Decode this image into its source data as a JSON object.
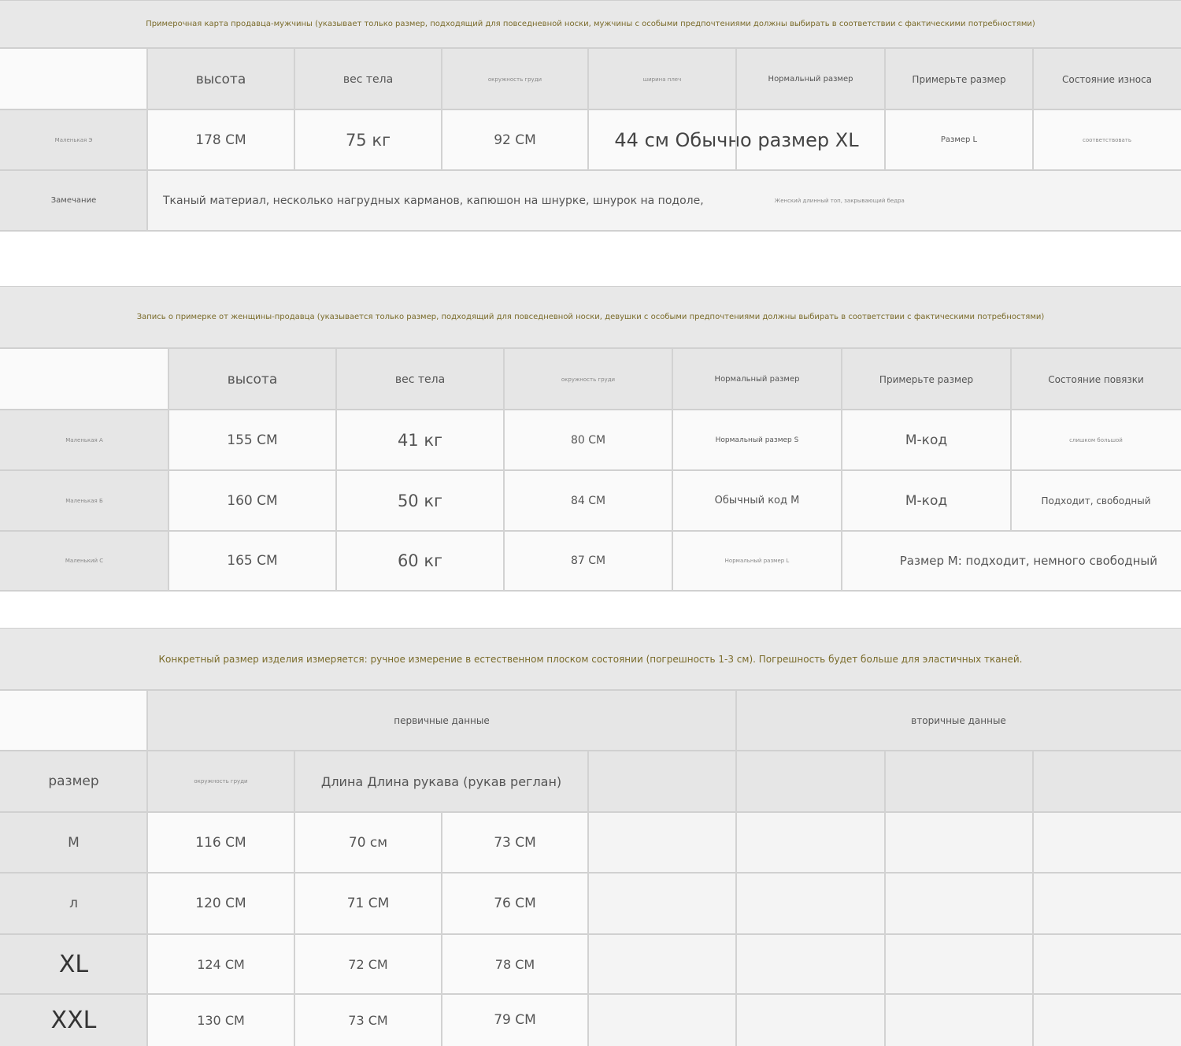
{
  "male": {
    "banner": "Примерочная карта продавца-мужчины (указывает только размер, подходящий для повседневной носки, мужчины с особыми предпочтениями должны выбирать в соответствии с фактическими потребностями)",
    "headers": [
      "высота",
      "вес тела",
      "окружность груди",
      "ширина плеч",
      "Нормальный размер",
      "Примерьте размер",
      "Состояние износа"
    ],
    "row": {
      "name": "Маленькая Э",
      "height": "178 СМ",
      "weight": "75 кг",
      "chest": "92 СМ",
      "shoulder_size": "44 см Обычно размер XL",
      "try_size": "Размер L",
      "fit": "соответствовать"
    },
    "note_label": "Замечание",
    "note_text": "Тканый материал, несколько нагрудных карманов, капюшон на шнурке, шнурок на подоле,",
    "note_extra": "Женский длинный топ, закрывающий бедра"
  },
  "female": {
    "banner": "Запись о примерке от женщины-продавца (указывается только размер, подходящий для повседневной носки, девушки с особыми предпочтениями должны выбирать в соответствии с фактическими потребностями)",
    "headers": [
      "высота",
      "вес тела",
      "окружность груди",
      "Нормальный размер",
      "Примерьте размер",
      "Состояние повязки"
    ],
    "rows": [
      {
        "name": "Маленькая А",
        "height": "155 СМ",
        "weight": "41 кг",
        "chest": "80 СМ",
        "normal": "Нормальный размер S",
        "try": "М-код",
        "fit": "слишком большой"
      },
      {
        "name": "Маленькая Б",
        "height": "160 СМ",
        "weight": "50 кг",
        "chest": "84 СМ",
        "normal": "Обычный код М",
        "try": "М-код",
        "fit": "Подходит, свободный"
      },
      {
        "name": "Маленький С",
        "height": "165 СМ",
        "weight": "60 кг",
        "chest": "87 СМ",
        "normal": "Нормальный размер L",
        "try_fit": "Размер М: подходит, немного свободный"
      }
    ]
  },
  "product": {
    "banner": "Конкретный размер изделия измеряется: ручное измерение в естественном плоском состоянии (погрешность 1-3 см). Погрешность будет больше для эластичных тканей.",
    "primary": "первичные данные",
    "secondary": "вторичные данные",
    "size_label": "размер",
    "chest_label": "окружность груди",
    "length_label": "Длина Длина рукава (рукав реглан)",
    "rows": [
      {
        "size": "М",
        "chest": "116 СМ",
        "length": "70 см",
        "sleeve": "73 СМ"
      },
      {
        "size": "л",
        "chest": "120 СМ",
        "length": "71 СМ",
        "sleeve": "76 СМ"
      },
      {
        "size": "XL",
        "chest": "124 СМ",
        "length": "72 СМ",
        "sleeve": "78 СМ"
      },
      {
        "size": "XXL",
        "chest": "130 СМ",
        "length": "73 СМ",
        "sleeve": "79 СМ"
      }
    ]
  }
}
